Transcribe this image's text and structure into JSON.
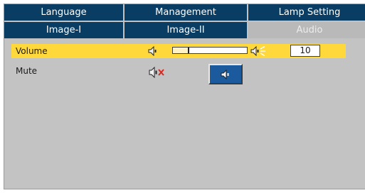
{
  "tabs_row1": [
    {
      "label": "Language",
      "active": false
    },
    {
      "label": "Management",
      "active": false
    },
    {
      "label": "Lamp Setting",
      "active": false
    }
  ],
  "tabs_row2": [
    {
      "label": "Image-I",
      "active": false
    },
    {
      "label": "Image-II",
      "active": false
    },
    {
      "label": "Audio",
      "active": true
    }
  ],
  "volume": {
    "label": "Volume",
    "value": "10",
    "level_fraction": 0.2,
    "icons": [
      "speaker-low-icon",
      "speaker-high-icon"
    ]
  },
  "mute": {
    "label": "Mute",
    "icons": [
      "speaker-muted-icon",
      "speaker-on-icon"
    ],
    "selected": "off"
  },
  "colors": {
    "tab_bg": "#0a3d63",
    "active_tab_bg": "#b9b9b9",
    "panel_bg": "#c3c3c3",
    "highlight_row": "#ffd83b",
    "selected_button": "#1b5a9c"
  }
}
